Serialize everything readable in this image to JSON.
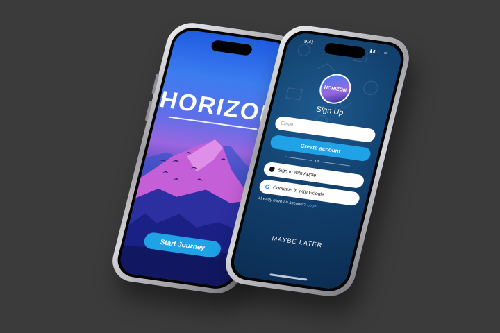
{
  "splash": {
    "brand": "HORIZON",
    "cta_label": "Start Journey"
  },
  "signup": {
    "status_time": "9:41",
    "status_icons": "▮▮ ◠ ▭",
    "avatar_brand": "HORIZON",
    "title": "Sign Up",
    "email_placeholder": "Email",
    "create_label": "Create account",
    "or_label": "or",
    "apple_label": "Sign in with Apple",
    "google_label": "Continue in with Google",
    "google_icon": "G",
    "account_prompt": "Already have an account?",
    "login_link": "Login",
    "later_label": "MAYBE LATER"
  },
  "colors": {
    "background": "#3b3b3b",
    "accent": "#1fa2e6",
    "signup_bg": "#12406d"
  }
}
